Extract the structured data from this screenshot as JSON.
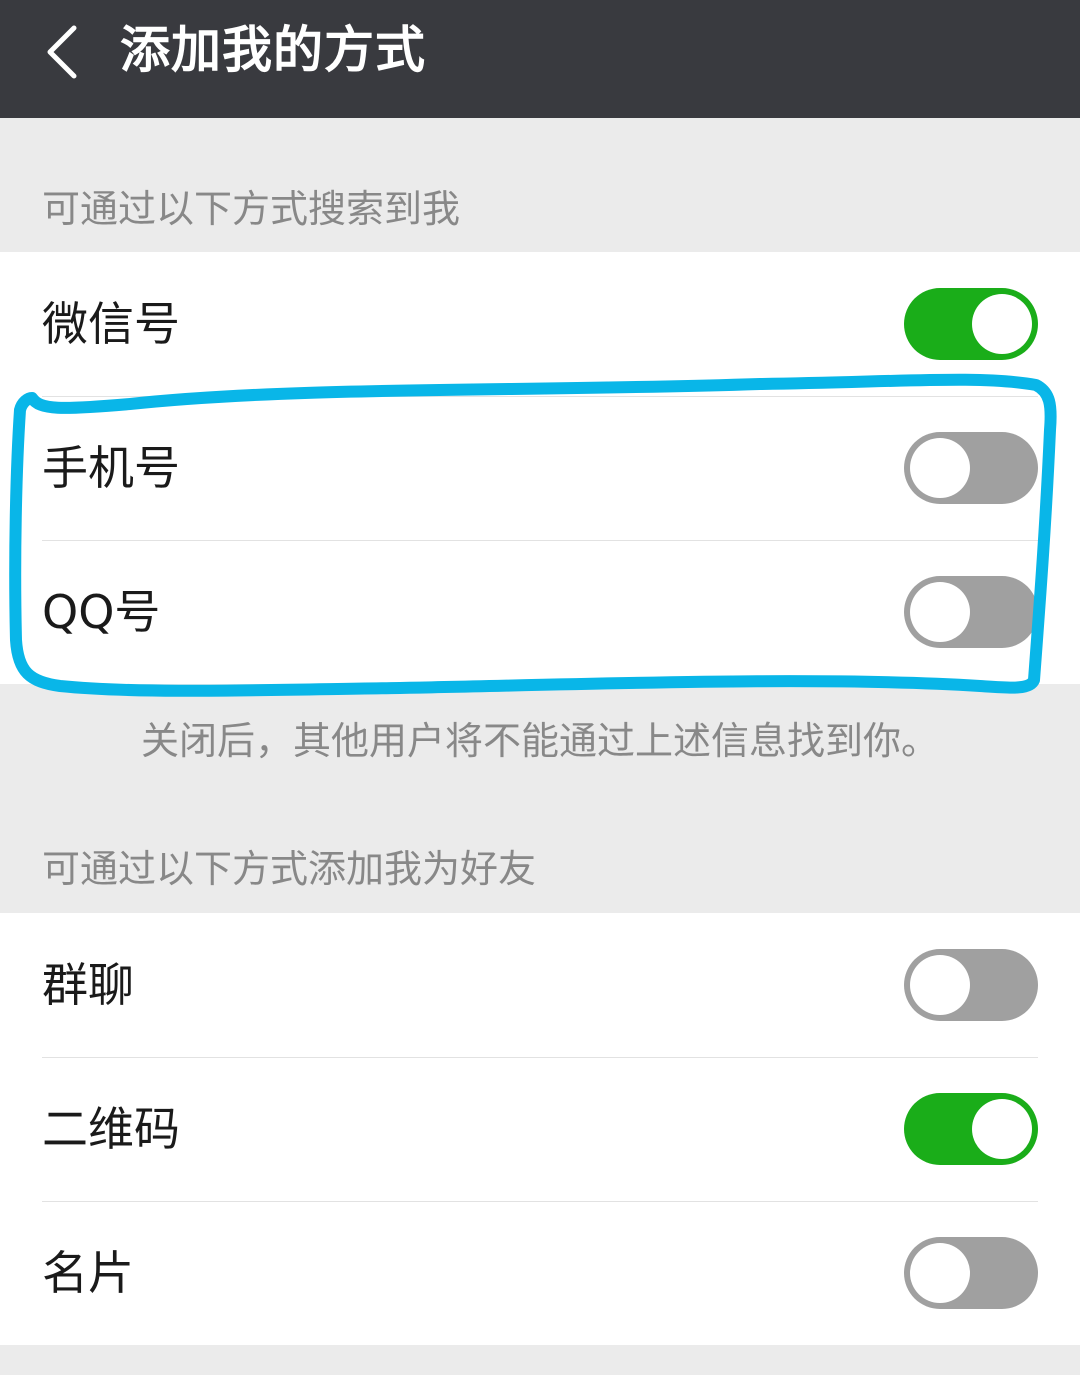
{
  "header": {
    "back_icon": "chevron-left-icon",
    "title": "添加我的方式"
  },
  "search_section": {
    "label": "可通过以下方式搜索到我",
    "items": [
      {
        "label": "微信号",
        "enabled": true
      },
      {
        "label": "手机号",
        "enabled": false
      },
      {
        "label": "QQ号",
        "enabled": false
      }
    ],
    "hint": "关闭后，其他用户将不能通过上述信息找到你。"
  },
  "add_section": {
    "label": "可通过以下方式添加我为好友",
    "items": [
      {
        "label": "群聊",
        "enabled": false
      },
      {
        "label": "二维码",
        "enabled": true
      },
      {
        "label": "名片",
        "enabled": false
      }
    ]
  },
  "colors": {
    "header_bg": "#393a3f",
    "toggle_on": "#1aad19",
    "toggle_off": "#a0a0a0",
    "annotation": "#09b6e8"
  }
}
